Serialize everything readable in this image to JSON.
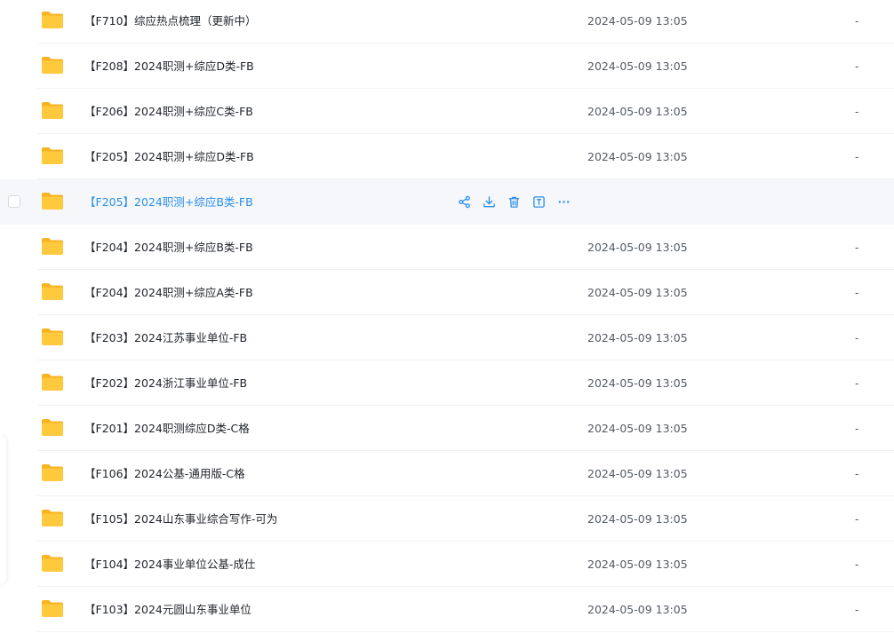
{
  "colors": {
    "folder_body": "#FFC93D",
    "folder_tab": "#F7B422",
    "hover_row_bg": "#F5F7FB",
    "link_blue": "#2A8FE8",
    "action_icon": "#2A8FE8"
  },
  "files": [
    {
      "name": "【F710】综应热点梳理（更新中）",
      "date": "2024-05-09 13:05",
      "size": "-"
    },
    {
      "name": "【F208】2024职测+综应D类-FB",
      "date": "2024-05-09 13:05",
      "size": "-"
    },
    {
      "name": "【F206】2024职测+综应C类-FB",
      "date": "2024-05-09 13:05",
      "size": "-"
    },
    {
      "name": "【F205】2024职测+综应D类-FB",
      "date": "2024-05-09 13:05",
      "size": "-"
    },
    {
      "name": "【F205】2024职测+综应B类-FB",
      "date": "",
      "size": ""
    },
    {
      "name": "【F204】2024职测+综应B类-FB",
      "date": "2024-05-09 13:05",
      "size": "-"
    },
    {
      "name": "【F204】2024职测+综应A类-FB",
      "date": "2024-05-09 13:05",
      "size": "-"
    },
    {
      "name": "【F203】2024江苏事业单位-FB",
      "date": "2024-05-09 13:05",
      "size": "-"
    },
    {
      "name": "【F202】2024浙江事业单位-FB",
      "date": "2024-05-09 13:05",
      "size": "-"
    },
    {
      "name": "【F201】2024职测综应D类-C格",
      "date": "2024-05-09 13:05",
      "size": "-"
    },
    {
      "name": "【F106】2024公基-通用版-C格",
      "date": "2024-05-09 13:05",
      "size": "-"
    },
    {
      "name": "【F105】2024山东事业综合写作-可为",
      "date": "2024-05-09 13:05",
      "size": "-"
    },
    {
      "name": "【F104】2024事业单位公基-成仕",
      "date": "2024-05-09 13:05",
      "size": "-"
    },
    {
      "name": "【F103】2024元圆山东事业单位",
      "date": "2024-05-09 13:05",
      "size": "-"
    }
  ],
  "hover_actions": [
    "share-icon",
    "download-icon",
    "delete-icon",
    "rename-icon",
    "more-icon"
  ]
}
